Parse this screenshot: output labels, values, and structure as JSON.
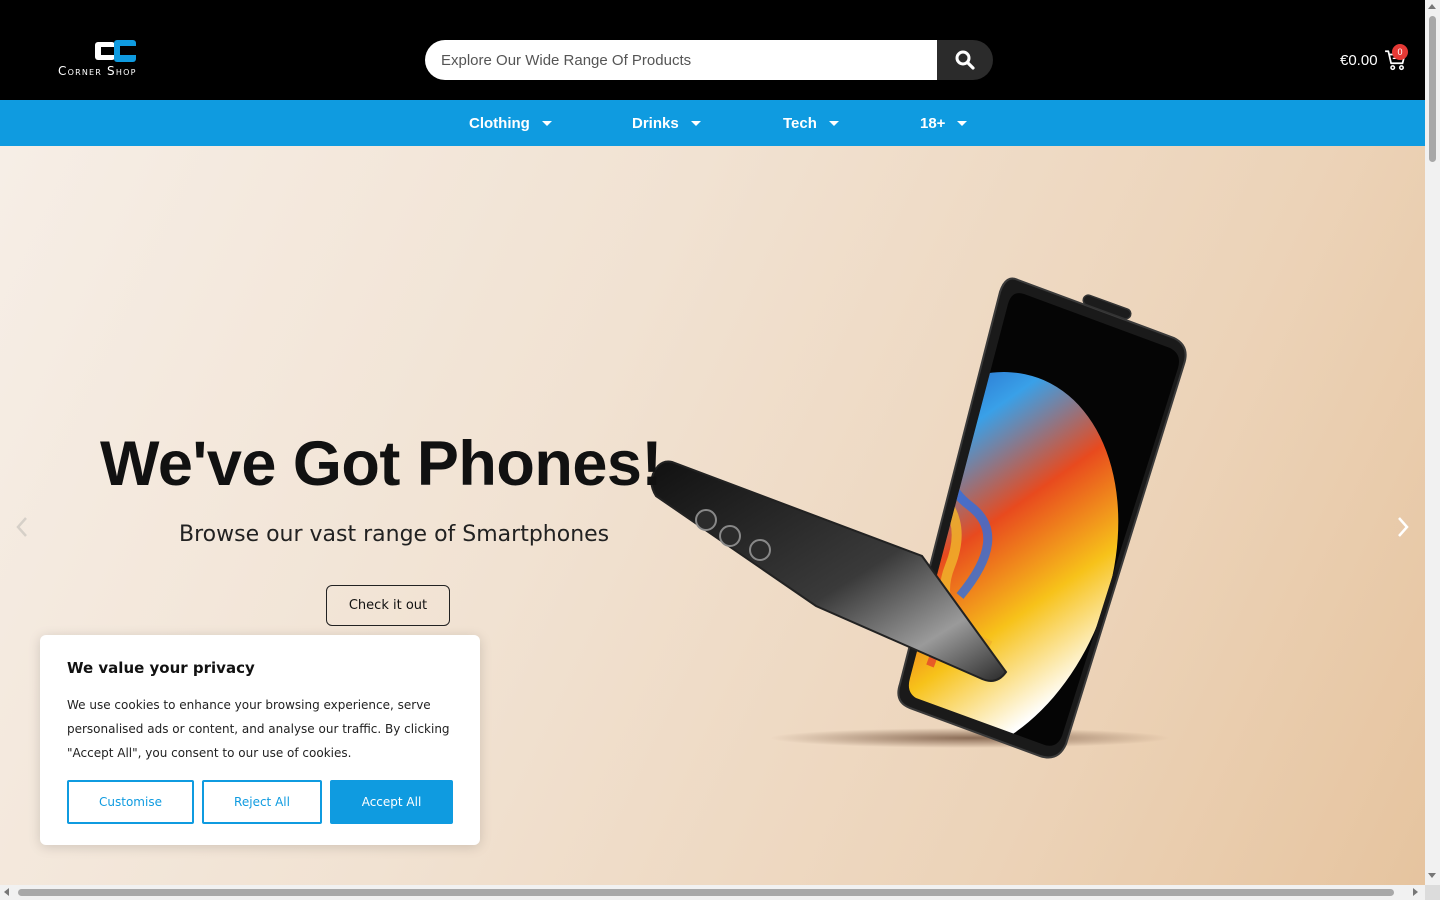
{
  "header": {
    "logo_text": "Corner Shop",
    "search_placeholder": "Explore Our Wide Range Of Products",
    "cart_total": "€0.00",
    "cart_count": "0"
  },
  "nav": {
    "items": [
      {
        "label": "Clothing"
      },
      {
        "label": "Drinks"
      },
      {
        "label": "Tech"
      },
      {
        "label": "18+"
      }
    ]
  },
  "hero": {
    "title": "We've Got Phones!",
    "subtitle": "Browse our vast range of Smartphones",
    "button": "Check it out"
  },
  "cookie": {
    "title": "We value your privacy",
    "text": "We use cookies to enhance your browsing experience, serve personalised ads or content, and analyse our traffic. By clicking \"Accept All\", you consent to our use of cookies.",
    "customise": "Customise",
    "reject": "Reject All",
    "accept": "Accept All"
  },
  "colors": {
    "header_bg": "#000000",
    "nav_bg": "#0f9be0",
    "accent": "#0f9be0",
    "cart_badge": "#e53935"
  },
  "icons": [
    "search-icon",
    "cart-icon",
    "chevron-left-icon",
    "chevron-right-icon",
    "caret-down-icon"
  ]
}
